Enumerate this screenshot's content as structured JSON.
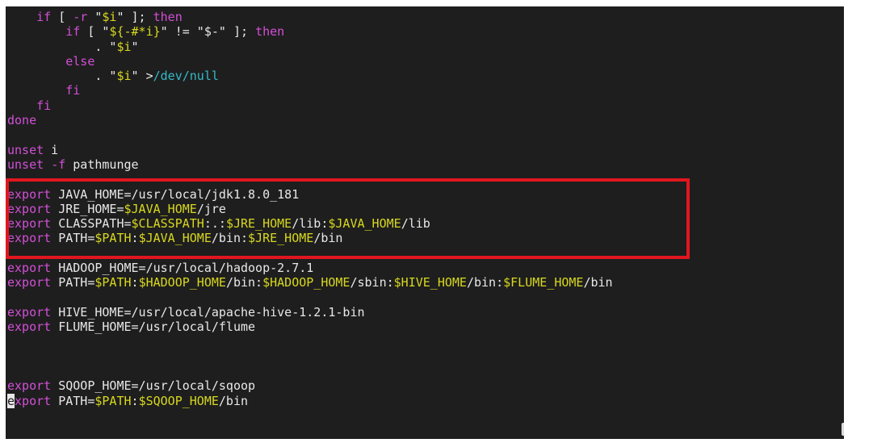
{
  "terminal": {
    "lines": [
      [
        {
          "t": "    "
        },
        {
          "t": "if",
          "c": "kw"
        },
        {
          "t": " [ "
        },
        {
          "t": "-r",
          "c": "kw"
        },
        {
          "t": " \""
        },
        {
          "t": "$i",
          "c": "var"
        },
        {
          "t": "\" ]; "
        },
        {
          "t": "then",
          "c": "kw"
        }
      ],
      [
        {
          "t": "        "
        },
        {
          "t": "if",
          "c": "kw"
        },
        {
          "t": " [ \""
        },
        {
          "t": "${-#*i}",
          "c": "var"
        },
        {
          "t": "\" != \"$-\" ]; "
        },
        {
          "t": "then",
          "c": "kw"
        }
      ],
      [
        {
          "t": "            . \""
        },
        {
          "t": "$i",
          "c": "var"
        },
        {
          "t": "\""
        }
      ],
      [
        {
          "t": "        "
        },
        {
          "t": "else",
          "c": "kw"
        }
      ],
      [
        {
          "t": "            . \""
        },
        {
          "t": "$i",
          "c": "var"
        },
        {
          "t": "\" >"
        },
        {
          "t": "/dev/null",
          "c": "path"
        }
      ],
      [
        {
          "t": "        "
        },
        {
          "t": "fi",
          "c": "kw"
        }
      ],
      [
        {
          "t": "    "
        },
        {
          "t": "fi",
          "c": "kw"
        }
      ],
      [
        {
          "t": "done",
          "c": "kw"
        }
      ],
      [],
      [
        {
          "t": "unset",
          "c": "kw"
        },
        {
          "t": " i"
        }
      ],
      [
        {
          "t": "unset",
          "c": "kw"
        },
        {
          "t": " "
        },
        {
          "t": "-f",
          "c": "kw"
        },
        {
          "t": " pathmunge"
        }
      ],
      [],
      [
        {
          "t": "export",
          "c": "kw"
        },
        {
          "t": " JAVA_HOME=/usr/local/jdk1.8.0_181"
        }
      ],
      [
        {
          "t": "export",
          "c": "kw"
        },
        {
          "t": " JRE_HOME="
        },
        {
          "t": "$JAVA_HOME",
          "c": "var"
        },
        {
          "t": "/jre"
        }
      ],
      [
        {
          "t": "export",
          "c": "kw"
        },
        {
          "t": " CLASSPATH="
        },
        {
          "t": "$CLASSPATH",
          "c": "var"
        },
        {
          "t": ":.:"
        },
        {
          "t": "$JRE_HOME",
          "c": "var"
        },
        {
          "t": "/lib:"
        },
        {
          "t": "$JAVA_HOME",
          "c": "var"
        },
        {
          "t": "/lib"
        }
      ],
      [
        {
          "t": "export",
          "c": "kw"
        },
        {
          "t": " PATH="
        },
        {
          "t": "$PATH",
          "c": "var"
        },
        {
          "t": ":"
        },
        {
          "t": "$JAVA_HOME",
          "c": "var"
        },
        {
          "t": "/bin:"
        },
        {
          "t": "$JRE_HOME",
          "c": "var"
        },
        {
          "t": "/bin"
        }
      ],
      [],
      [
        {
          "t": "export",
          "c": "kw"
        },
        {
          "t": " HADOOP_HOME=/usr/local/hadoop-2.7.1"
        }
      ],
      [
        {
          "t": "export",
          "c": "kw"
        },
        {
          "t": " PATH="
        },
        {
          "t": "$PATH",
          "c": "var"
        },
        {
          "t": ":"
        },
        {
          "t": "$HADOOP_HOME",
          "c": "var"
        },
        {
          "t": "/bin:"
        },
        {
          "t": "$HADOOP_HOME",
          "c": "var"
        },
        {
          "t": "/sbin:"
        },
        {
          "t": "$HIVE_HOME",
          "c": "var"
        },
        {
          "t": "/bin:"
        },
        {
          "t": "$FLUME_HOME",
          "c": "var"
        },
        {
          "t": "/bin"
        }
      ],
      [],
      [
        {
          "t": "export",
          "c": "kw"
        },
        {
          "t": " HIVE_HOME=/usr/local/apache-hive-1.2.1-bin"
        }
      ],
      [
        {
          "t": "export",
          "c": "kw"
        },
        {
          "t": " FLUME_HOME=/usr/local/flume"
        }
      ],
      [],
      [],
      [],
      [
        {
          "t": "export",
          "c": "kw"
        },
        {
          "t": " SQOOP_HOME=/usr/local/sqoop"
        }
      ],
      [
        {
          "t": "e",
          "c": "cursor"
        },
        {
          "t": "xport",
          "c": "kw"
        },
        {
          "t": " PATH="
        },
        {
          "t": "$PATH",
          "c": "var"
        },
        {
          "t": ":"
        },
        {
          "t": "$SQOOP_HOME",
          "c": "var"
        },
        {
          "t": "/bin"
        }
      ]
    ]
  },
  "colors": {
    "background": "#1e1e1e",
    "keyword": "#d24fd6",
    "variable": "#d8d81e",
    "path": "#35b9c9",
    "text": "#e8e8e8",
    "highlight_border": "#e0161e"
  }
}
